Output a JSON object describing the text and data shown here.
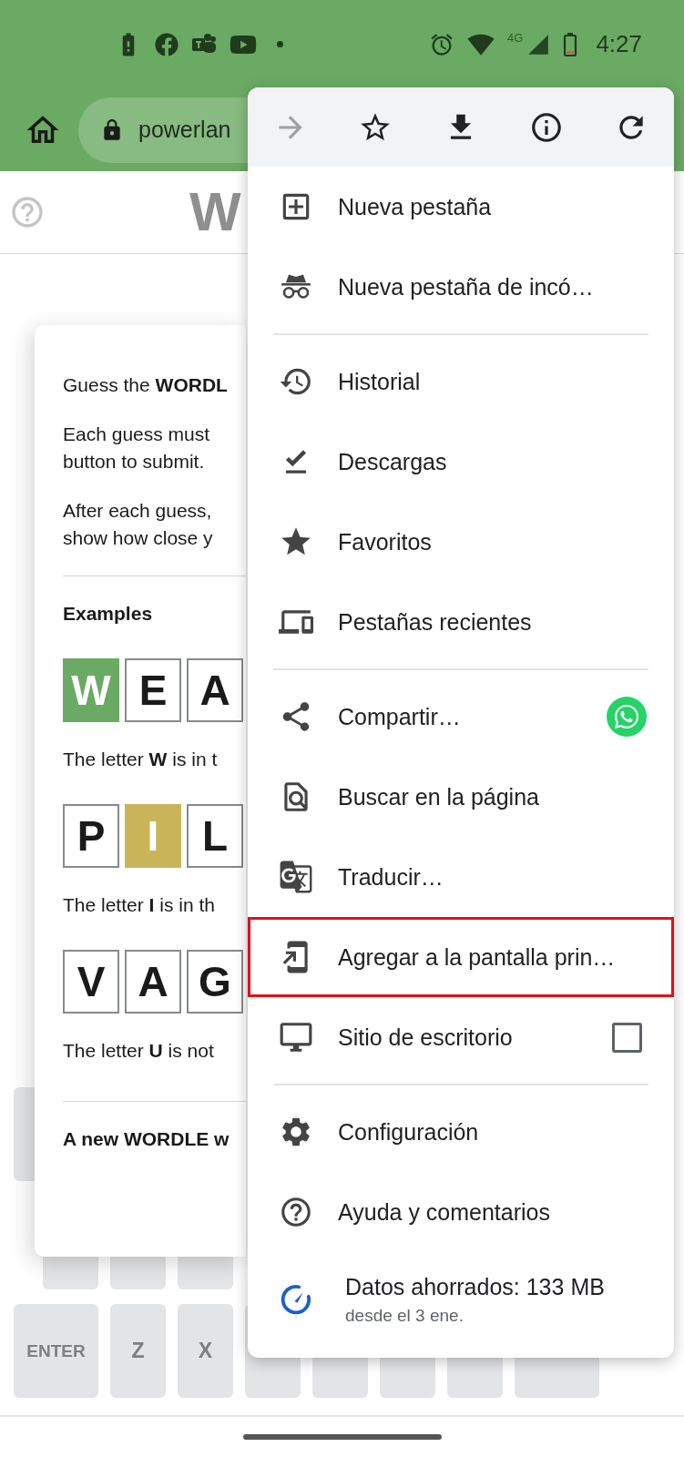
{
  "status_bar": {
    "network": "4G",
    "time": "4:27"
  },
  "browser_toolbar": {
    "url": "powerlan"
  },
  "header": {
    "title": "W"
  },
  "help_card": {
    "intro": "Guess the **WORDL**",
    "paragraphs": [
      [
        "Each guess must",
        "button to submit."
      ],
      [
        "After each guess,",
        "show how close y"
      ]
    ],
    "examples_heading": "Examples",
    "examples": [
      {
        "tiles": [
          {
            "letter": "W",
            "kind": "correct"
          },
          {
            "letter": "E",
            "kind": "empty"
          },
          {
            "letter": "A",
            "kind": "empty"
          }
        ],
        "caption": "The letter **W** is in t"
      },
      {
        "tiles": [
          {
            "letter": "P",
            "kind": "empty"
          },
          {
            "letter": "I",
            "kind": "present"
          },
          {
            "letter": "L",
            "kind": "empty"
          }
        ],
        "caption": "The letter **I** is in th"
      },
      {
        "tiles": [
          {
            "letter": "V",
            "kind": "empty"
          },
          {
            "letter": "A",
            "kind": "empty"
          },
          {
            "letter": "G",
            "kind": "empty"
          }
        ],
        "caption": "The letter **U** is not"
      }
    ],
    "footer": "A new WORDLE w"
  },
  "keyboard": {
    "rows": [
      [
        {
          "kind": "blank"
        }
      ],
      [
        {
          "kind": "blank"
        },
        {
          "kind": "blank"
        },
        {
          "kind": "blank"
        }
      ],
      [
        {
          "kind": "wide",
          "label": "ENTER"
        },
        {
          "kind": "letter",
          "label": "Z"
        },
        {
          "kind": "letter",
          "label": "X"
        },
        {
          "kind": "blank"
        },
        {
          "kind": "blank"
        },
        {
          "kind": "blank"
        },
        {
          "kind": "blank"
        },
        {
          "kind": "wide"
        }
      ]
    ]
  },
  "menu": {
    "toolbar": [
      {
        "disabled": true
      },
      {
        "disabled": false
      },
      {
        "disabled": false
      },
      {
        "disabled": false
      },
      {
        "disabled": false
      }
    ],
    "sections": [
      [
        {
          "kind": "plain",
          "label": "Nueva pestaña",
          "highlighted": false
        },
        {
          "kind": "plain",
          "label": "Nueva pestaña de incó…",
          "highlighted": false
        }
      ],
      [
        {
          "kind": "plain",
          "label": "Historial",
          "highlighted": false
        },
        {
          "kind": "plain",
          "label": "Descargas",
          "highlighted": false
        },
        {
          "kind": "plain",
          "label": "Favoritos",
          "highlighted": false
        },
        {
          "kind": "plain",
          "label": "Pestañas recientes",
          "highlighted": false
        }
      ],
      [
        {
          "kind": "share",
          "label": "Compartir…",
          "highlighted": false
        },
        {
          "kind": "plain",
          "label": "Buscar en la página",
          "highlighted": false
        },
        {
          "kind": "plain",
          "label": "Traducir…",
          "highlighted": false
        },
        {
          "kind": "plain",
          "label": "Agregar a la pantalla prin…",
          "highlighted": true
        },
        {
          "kind": "checkbox",
          "label": "Sitio de escritorio",
          "checked": false,
          "highlighted": false
        }
      ],
      [
        {
          "kind": "plain",
          "label": "Configuración",
          "highlighted": false
        },
        {
          "kind": "plain",
          "label": "Ayuda y comentarios",
          "highlighted": false
        },
        {
          "kind": "data",
          "label": "Datos ahorrados: 133 MB",
          "sublabel": "desde el 3 ene.",
          "highlighted": false
        }
      ]
    ]
  }
}
